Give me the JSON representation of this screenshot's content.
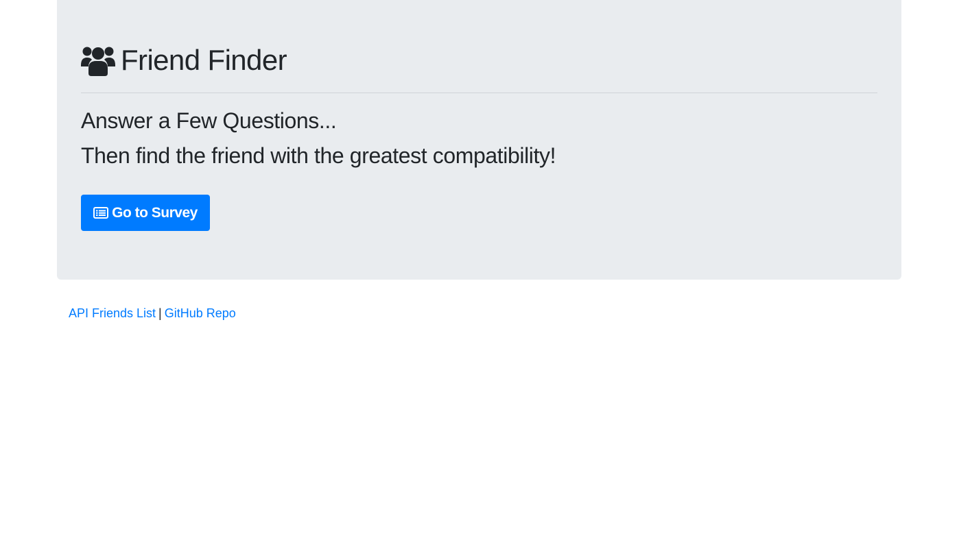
{
  "header": {
    "title": "Friend Finder",
    "icon": "users-icon"
  },
  "intro": {
    "line1": "Answer a Few Questions...",
    "line2": "Then find the friend with the greatest compatibility!"
  },
  "survey_button": {
    "label": "Go to Survey",
    "icon": "list-alt-icon",
    "color": "#007bff"
  },
  "footer": {
    "links": [
      {
        "label": "API Friends List"
      },
      {
        "label": "GitHub Repo"
      }
    ],
    "separator": "|"
  },
  "colors": {
    "jumbotron_bg": "#e9ecef",
    "text": "#212529",
    "link": "#007bff"
  }
}
